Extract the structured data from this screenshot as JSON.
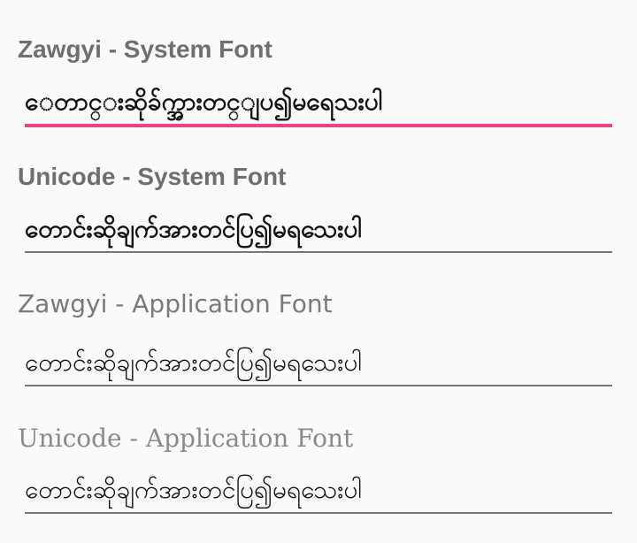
{
  "sections": [
    {
      "label": "Zawgyi - System Font",
      "value": "ေတာင္းဆိုခ်က္အားတင္ျပ၍မရေသးပါ"
    },
    {
      "label": "Unicode - System Font",
      "value": "တောင်းဆိုချက်အားတင်ပြ၍မရသေးပါ"
    },
    {
      "label": "Zawgyi - Application Font",
      "value": "တောင်းဆိုချက်အားတင်ပြ၍မရသေးပါ"
    },
    {
      "label": "Unicode - Application Font",
      "value": "တောင်းဆိုချက်အားတင်ပြ၍မရသေးပါ"
    }
  ],
  "colors": {
    "accent": "#e94583",
    "underline": "#777777",
    "label": "#6f6f6f",
    "background": "#fafafa"
  }
}
